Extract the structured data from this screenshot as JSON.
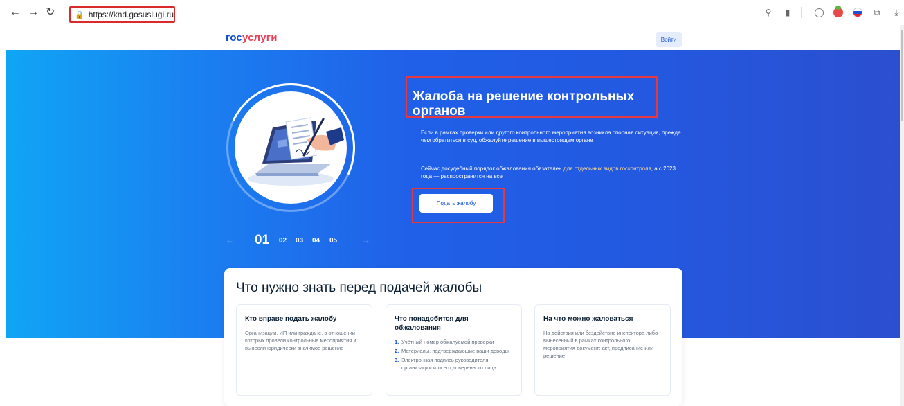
{
  "browser": {
    "back": "←",
    "forward": "→",
    "reload": "↻",
    "url": "https://knd.gosuslugi.ru"
  },
  "header": {
    "logo_gos": "гос",
    "logo_uslugi": "услуги",
    "login_label": "Войти"
  },
  "hero": {
    "title": "Жалоба на решение контрольных органов",
    "description": "Если в рамках проверки или другого контрольного мероприятия возникла спорная ситуация, прежде чем обратиться в суд, обжалуйте решение в вышестоящем органе",
    "note_before": "Сейчас досудебный порядок обжалования обязателен ",
    "note_link": "для отдельных видов госконтроля",
    "note_after": ", а с 2023 года — распространится на все",
    "cta_label": "Подать жалобу",
    "slides": {
      "prev": "←",
      "next": "→",
      "active": "01",
      "others": [
        "02",
        "03",
        "04",
        "05"
      ]
    }
  },
  "info": {
    "title": "Что нужно знать перед подачей жалобы",
    "columns": [
      {
        "title": "Кто вправе подать жалобу",
        "text": "Организации, ИП или граждане, в отношении которых провели контрольные мероприятия и вынесли юридически значимое решение"
      },
      {
        "title": "Что понадобится для обжалования",
        "items": [
          {
            "n": "1.",
            "text": "Учётный номер обжалуемой проверки"
          },
          {
            "n": "2.",
            "text": "Материалы, подтверждающие ваши доводы"
          },
          {
            "n": "3.",
            "text": "Электронная подпись руководителя организации или его доверенного лица"
          }
        ]
      },
      {
        "title": "На что можно жаловаться",
        "text": "На действия или бездействие инспектора либо вынесенный в рамках контрольного мероприятия документ: акт, предписание или решение"
      }
    ]
  }
}
